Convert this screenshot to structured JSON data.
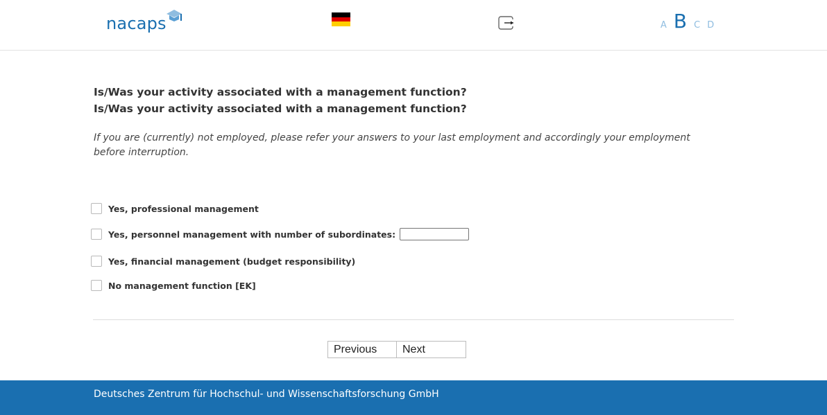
{
  "header": {
    "logo_text": "nacaps",
    "language_flag": "german-flag-icon",
    "logout_icon": "logout-icon",
    "font_sizes": [
      "A",
      "B",
      "C",
      "D"
    ],
    "active_font_size": "B"
  },
  "question": {
    "line1": "Is/Was your activity associated with a management function?",
    "line2": "Is/Was your activity associated with a management function?",
    "hint": "If you are (currently) not employed, please refer your answers to your last employment and accordingly your employment before interruption."
  },
  "options": [
    {
      "label": "Yes, professional management",
      "checked": false
    },
    {
      "label": "Yes, personnel management with number of subordinates:",
      "checked": false,
      "input_value": ""
    },
    {
      "label": "Yes, financial management (budget responsibility)",
      "checked": false
    },
    {
      "label": "No management function [EK]",
      "checked": false
    }
  ],
  "nav": {
    "previous_label": "Previous",
    "next_label": "Next"
  },
  "footer": {
    "text": "Deutsches Zentrum für Hochschul- und Wissenschaftsforschung GmbH"
  },
  "colors": {
    "brand": "#1a6fb0",
    "footer_bg": "#1a6fb0"
  }
}
